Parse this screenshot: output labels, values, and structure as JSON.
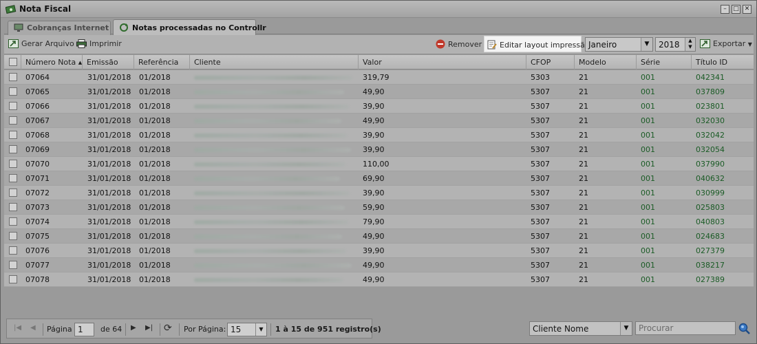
{
  "window": {
    "title": "Nota Fiscal",
    "controls": [
      "minimize",
      "maximize",
      "close"
    ]
  },
  "tabs": [
    {
      "label": "Cobranças Internet",
      "active": false,
      "icon": "monitor-icon"
    },
    {
      "label": "Notas processadas no Controllr",
      "active": true,
      "icon": "refresh-icon"
    }
  ],
  "toolbar": {
    "generate_label": "Gerar Arquivo",
    "print_label": "Imprimir",
    "remove_label": "Remover",
    "edit_layout_label": "Editar layout impressão",
    "month_value": "Janeiro",
    "year_value": "2018",
    "export_label": "Exportar"
  },
  "columns": [
    "Número Nota",
    "Emissão",
    "Referência",
    "Cliente",
    "Valor",
    "CFOP",
    "Modelo",
    "Série",
    "Título ID"
  ],
  "sort": {
    "column": "Número Nota",
    "direction": "asc"
  },
  "rows": [
    {
      "numero": "07064",
      "emissao": "31/01/2018",
      "referencia": "01/2018",
      "valor": "319,79",
      "cfop": "5303",
      "modelo": "21",
      "serie": "001",
      "titulo": "042341"
    },
    {
      "numero": "07065",
      "emissao": "31/01/2018",
      "referencia": "01/2018",
      "valor": "49,90",
      "cfop": "5307",
      "modelo": "21",
      "serie": "001",
      "titulo": "037809"
    },
    {
      "numero": "07066",
      "emissao": "31/01/2018",
      "referencia": "01/2018",
      "valor": "39,90",
      "cfop": "5307",
      "modelo": "21",
      "serie": "001",
      "titulo": "023801"
    },
    {
      "numero": "07067",
      "emissao": "31/01/2018",
      "referencia": "01/2018",
      "valor": "49,90",
      "cfop": "5307",
      "modelo": "21",
      "serie": "001",
      "titulo": "032030"
    },
    {
      "numero": "07068",
      "emissao": "31/01/2018",
      "referencia": "01/2018",
      "valor": "39,90",
      "cfop": "5307",
      "modelo": "21",
      "serie": "001",
      "titulo": "032042"
    },
    {
      "numero": "07069",
      "emissao": "31/01/2018",
      "referencia": "01/2018",
      "valor": "39,90",
      "cfop": "5307",
      "modelo": "21",
      "serie": "001",
      "titulo": "032054"
    },
    {
      "numero": "07070",
      "emissao": "31/01/2018",
      "referencia": "01/2018",
      "valor": "110,00",
      "cfop": "5307",
      "modelo": "21",
      "serie": "001",
      "titulo": "037990"
    },
    {
      "numero": "07071",
      "emissao": "31/01/2018",
      "referencia": "01/2018",
      "valor": "69,90",
      "cfop": "5307",
      "modelo": "21",
      "serie": "001",
      "titulo": "040632"
    },
    {
      "numero": "07072",
      "emissao": "31/01/2018",
      "referencia": "01/2018",
      "valor": "39,90",
      "cfop": "5307",
      "modelo": "21",
      "serie": "001",
      "titulo": "030999"
    },
    {
      "numero": "07073",
      "emissao": "31/01/2018",
      "referencia": "01/2018",
      "valor": "59,90",
      "cfop": "5307",
      "modelo": "21",
      "serie": "001",
      "titulo": "025803"
    },
    {
      "numero": "07074",
      "emissao": "31/01/2018",
      "referencia": "01/2018",
      "valor": "79,90",
      "cfop": "5307",
      "modelo": "21",
      "serie": "001",
      "titulo": "040803"
    },
    {
      "numero": "07075",
      "emissao": "31/01/2018",
      "referencia": "01/2018",
      "valor": "49,90",
      "cfop": "5307",
      "modelo": "21",
      "serie": "001",
      "titulo": "024683"
    },
    {
      "numero": "07076",
      "emissao": "31/01/2018",
      "referencia": "01/2018",
      "valor": "39,90",
      "cfop": "5307",
      "modelo": "21",
      "serie": "001",
      "titulo": "027379"
    },
    {
      "numero": "07077",
      "emissao": "31/01/2018",
      "referencia": "01/2018",
      "valor": "49,90",
      "cfop": "5307",
      "modelo": "21",
      "serie": "001",
      "titulo": "038217"
    },
    {
      "numero": "07078",
      "emissao": "31/01/2018",
      "referencia": "01/2018",
      "valor": "49,90",
      "cfop": "5307",
      "modelo": "21",
      "serie": "001",
      "titulo": "027389"
    }
  ],
  "pager": {
    "page_label": "Página",
    "page_value": "1",
    "of_label": "de 64",
    "per_page_label": "Por Página:",
    "per_page_value": "15",
    "summary": "1 à 15 de 951 registro(s)"
  },
  "search": {
    "field_value": "Cliente Nome",
    "placeholder": "Procurar"
  },
  "colors": {
    "green_text": "#1a5b25",
    "remove_red": "#c0392b"
  }
}
